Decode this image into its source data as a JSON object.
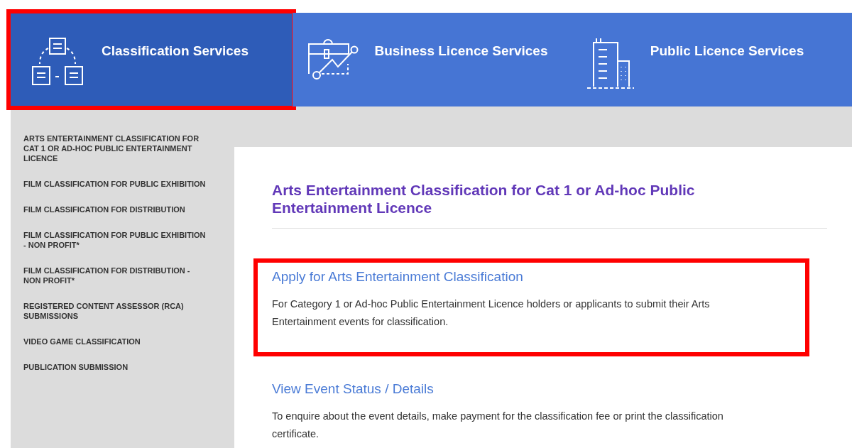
{
  "tabs": [
    {
      "label": "Classification Services",
      "kind": "flow",
      "selected": true,
      "highlighted": true
    },
    {
      "label": "Business Licence Services",
      "kind": "briefcase",
      "selected": false,
      "highlighted": false
    },
    {
      "label": "Public Licence Services",
      "kind": "building",
      "selected": false,
      "highlighted": false
    }
  ],
  "sidebar": {
    "items": [
      "ARTS ENTERTAINMENT CLASSIFICATION FOR CAT 1 OR AD-HOC PUBLIC ENTERTAINMENT LICENCE",
      "FILM CLASSIFICATION FOR PUBLIC EXHIBITION",
      "FILM CLASSIFICATION FOR DISTRIBUTION",
      "FILM CLASSIFICATION FOR PUBLIC EXHIBITION - NON PROFIT*",
      "FILM CLASSIFICATION FOR DISTRIBUTION - NON PROFIT*",
      "REGISTERED CONTENT ASSESSOR (RCA) SUBMISSIONS",
      "VIDEO GAME CLASSIFICATION",
      "PUBLICATION SUBMISSION"
    ]
  },
  "content": {
    "title": "Arts Entertainment Classification for Cat 1 or Ad-hoc Public Entertainment Licence",
    "sections": [
      {
        "heading": "Apply for Arts Entertainment Classification",
        "text": "For Category 1 or Ad-hoc Public Entertainment Licence holders or applicants to submit their Arts Entertainment events for classification.",
        "highlighted": true
      },
      {
        "heading": "View Event Status / Details",
        "text": "To enquire about the event details, make payment for the classification fee or print the classification certificate.",
        "highlighted": false
      }
    ]
  }
}
